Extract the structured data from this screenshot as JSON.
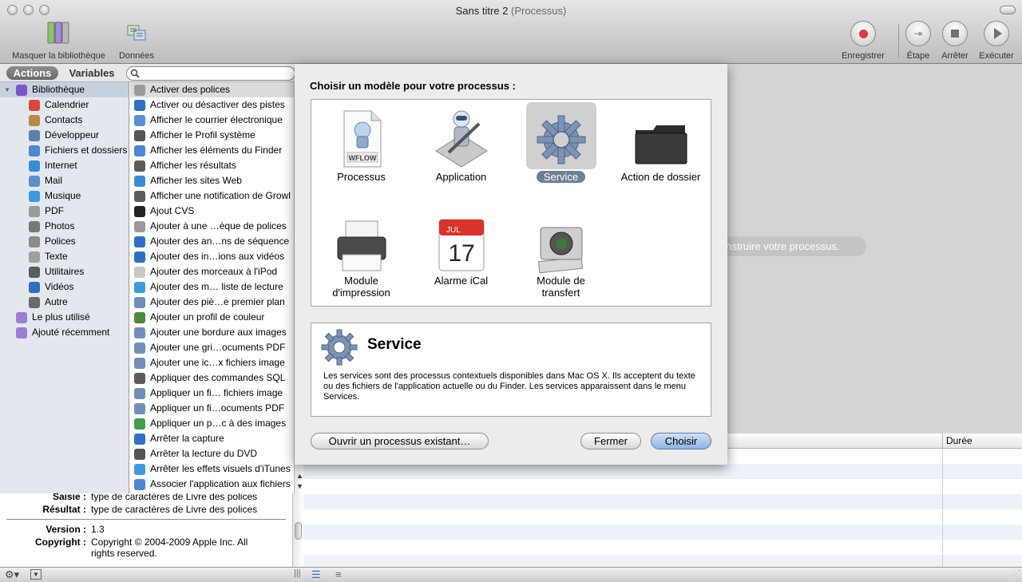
{
  "window": {
    "title": "Sans titre 2",
    "subtitle": "(Processus)"
  },
  "toolbar": {
    "hide_library": "Masquer la bibliothèque",
    "data": "Données",
    "record": "Enregistrer",
    "step": "Étape",
    "stop": "Arrêter",
    "run": "Exécuter"
  },
  "tabs": {
    "actions": "Actions",
    "variables": "Variables"
  },
  "search": {
    "placeholder": ""
  },
  "library": [
    {
      "label": "Bibliothèque",
      "level": 0,
      "icon": "library-icon",
      "color": "#7a57c7"
    },
    {
      "label": "Calendrier",
      "level": 1,
      "icon": "calendar-icon",
      "color": "#d9493a"
    },
    {
      "label": "Contacts",
      "level": 1,
      "icon": "contacts-icon",
      "color": "#b88a45"
    },
    {
      "label": "Développeur",
      "level": 1,
      "icon": "developer-icon",
      "color": "#5f7ea8"
    },
    {
      "label": "Fichiers et dossiers",
      "level": 1,
      "icon": "finder-icon",
      "color": "#4e86d0"
    },
    {
      "label": "Internet",
      "level": 1,
      "icon": "internet-icon",
      "color": "#3b8ad6"
    },
    {
      "label": "Mail",
      "level": 1,
      "icon": "mail-icon",
      "color": "#5a8fd0"
    },
    {
      "label": "Musique",
      "level": 1,
      "icon": "music-icon",
      "color": "#3d9ae0"
    },
    {
      "label": "PDF",
      "level": 1,
      "icon": "pdf-icon",
      "color": "#9a9a9a"
    },
    {
      "label": "Photos",
      "level": 1,
      "icon": "photos-icon",
      "color": "#777777"
    },
    {
      "label": "Polices",
      "level": 1,
      "icon": "fonts-icon",
      "color": "#8a8a8a"
    },
    {
      "label": "Texte",
      "level": 1,
      "icon": "text-icon",
      "color": "#9f9f9f"
    },
    {
      "label": "Utilitaires",
      "level": 1,
      "icon": "utilities-icon",
      "color": "#5c5c5c"
    },
    {
      "label": "Vidéos",
      "level": 1,
      "icon": "video-icon",
      "color": "#2f6fc2"
    },
    {
      "label": "Autre",
      "level": 1,
      "icon": "other-icon",
      "color": "#6a6a6a"
    },
    {
      "label": "Le plus utilisé",
      "level": 0,
      "icon": "smart-folder-icon",
      "color": "#9b7fd4"
    },
    {
      "label": "Ajouté récemment",
      "level": 0,
      "icon": "smart-folder-icon",
      "color": "#9b7fd4"
    }
  ],
  "actions": [
    {
      "label": "Activer des polices",
      "icon": "fonts-icon",
      "color": "#9a9a9a"
    },
    {
      "label": "Activer ou désactiver des pistes",
      "icon": "quicktime-icon",
      "color": "#2f6fc2"
    },
    {
      "label": "Afficher le courrier électronique",
      "icon": "mail-icon",
      "color": "#5a8fd0"
    },
    {
      "label": "Afficher le Profil système",
      "icon": "system-profiler-icon",
      "color": "#555555"
    },
    {
      "label": "Afficher les éléments du Finder",
      "icon": "finder-icon",
      "color": "#4e86d0"
    },
    {
      "label": "Afficher les résultats",
      "icon": "utilities-icon",
      "color": "#5c5c5c"
    },
    {
      "label": "Afficher les sites Web",
      "icon": "internet-icon",
      "color": "#3b8ad6"
    },
    {
      "label": "Afficher une notification de Growl",
      "icon": "utilities-icon",
      "color": "#5c5c5c"
    },
    {
      "label": "Ajout CVS",
      "icon": "terminal-icon",
      "color": "#222222"
    },
    {
      "label": "Ajouter à une …èque de polices",
      "icon": "fonts-icon",
      "color": "#9a9a9a"
    },
    {
      "label": "Ajouter des an…ns de séquence",
      "icon": "quicktime-icon",
      "color": "#2f6fc2"
    },
    {
      "label": "Ajouter des in…ions aux vidéos",
      "icon": "quicktime-icon",
      "color": "#2f6fc2"
    },
    {
      "label": "Ajouter des morceaux à l'iPod",
      "icon": "ipod-icon",
      "color": "#c8c8c8"
    },
    {
      "label": "Ajouter des m… liste de lecture",
      "icon": "music-icon",
      "color": "#3d9ae0"
    },
    {
      "label": "Ajouter des piè…e premier plan",
      "icon": "preview-icon",
      "color": "#6f8fb8"
    },
    {
      "label": "Ajouter un profil de couleur",
      "icon": "colorsync-icon",
      "color": "#4a8a3e"
    },
    {
      "label": "Ajouter une bordure aux images",
      "icon": "preview-icon",
      "color": "#6f8fb8"
    },
    {
      "label": "Ajouter une gri…ocuments PDF",
      "icon": "preview-icon",
      "color": "#6f8fb8"
    },
    {
      "label": "Ajouter une ic…x fichiers image",
      "icon": "preview-icon",
      "color": "#6f8fb8"
    },
    {
      "label": "Appliquer des commandes SQL",
      "icon": "utilities-icon",
      "color": "#5c5c5c"
    },
    {
      "label": "Appliquer un fi… fichiers image",
      "icon": "preview-icon",
      "color": "#6f8fb8"
    },
    {
      "label": "Appliquer un fi…ocuments PDF",
      "icon": "preview-icon",
      "color": "#6f8fb8"
    },
    {
      "label": "Appliquer un p…c à des images",
      "icon": "colorsync-icon",
      "color": "#3aa14a"
    },
    {
      "label": "Arrêter la capture",
      "icon": "quicktime-icon",
      "color": "#2f6fc2"
    },
    {
      "label": "Arrêter la lecture du DVD",
      "icon": "dvd-icon",
      "color": "#555555"
    },
    {
      "label": "Arrêter les effets visuels d'iTunes",
      "icon": "itunes-icon",
      "color": "#3d9ae0"
    },
    {
      "label": "Associer l'application aux fichiers",
      "icon": "finder-icon",
      "color": "#4e86d0"
    }
  ],
  "description": {
    "saisie_label": "Saisie :",
    "saisie_value": "type de caractères de Livre des polices",
    "resultat_label": "Résultat :",
    "resultat_value": "type de caractères de Livre des polices",
    "version_label": "Version :",
    "version_value": "1.3",
    "copyright_label": "Copyright :",
    "copyright_line1": "Copyright © 2004-2009 Apple Inc. All",
    "copyright_line2": "rights reserved."
  },
  "workflow": {
    "hint": "onstruire votre processus."
  },
  "log": {
    "duree": "Durée"
  },
  "sheet": {
    "title": "Choisir un modèle pour votre processus :",
    "templates": [
      {
        "name": "Processus",
        "line2": "",
        "icon": "workflow-document-icon",
        "icon_text": "WFLOW"
      },
      {
        "name": "Application",
        "line2": "",
        "icon": "automator-robot-icon",
        "icon_text": ""
      },
      {
        "name": "Service",
        "line2": "",
        "icon": "gear-icon",
        "icon_text": "",
        "selected": true
      },
      {
        "name": "Action de dossier",
        "line2": "",
        "icon": "folder-icon",
        "icon_text": ""
      },
      {
        "name": "Module",
        "line2": "d'impression",
        "icon": "printer-icon",
        "icon_text": ""
      },
      {
        "name": "Alarme iCal",
        "line2": "",
        "icon": "calendar-icon",
        "icon_text": "JUL",
        "icon_num": "17"
      },
      {
        "name": "Module de",
        "line2": "transfert",
        "icon": "camera-icon",
        "icon_text": ""
      }
    ],
    "info_title": "Service",
    "info_body": "Les services sont des processus contextuels disponibles dans Mac OS X. Ils acceptent du texte ou des fichiers de l'application actuelle ou du Finder. Les services apparaissent dans le menu Services.",
    "open_existing": "Ouvrir un processus existant…",
    "close": "Fermer",
    "choose": "Choisir"
  },
  "colors": {
    "accent": "#6d7f97",
    "selection": "#c7d1de",
    "record": "#e0383e",
    "sheet_bg": "#ececec"
  }
}
